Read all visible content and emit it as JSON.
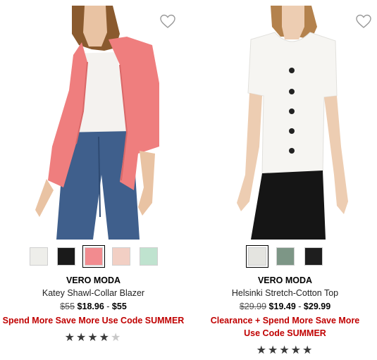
{
  "products": [
    {
      "brand": "VERO MODA",
      "name": "Katey Shawl-Collar Blazer",
      "price_original": "$55",
      "price_sale": "$18.96",
      "price_separator": "-",
      "price_max": "$55",
      "promo": "Spend More Save More Use Code SUMMER",
      "rating_stars": 4,
      "rating_max": 5,
      "swatches": [
        "#eeeeea",
        "#1a1a1a",
        "#f28b8f",
        "#f2cfc4",
        "#bfe3cf"
      ],
      "selected_swatch": 2,
      "wishlist_icon": "heart-outline-icon"
    },
    {
      "brand": "VERO MODA",
      "name": "Helsinki Stretch-Cotton Top",
      "price_original": "$29.99",
      "price_sale": "$19.49",
      "price_separator": "-",
      "price_max": "$29.99",
      "promo": "Clearance + Spend More Save More Use Code SUMMER",
      "rating_stars": 5,
      "rating_max": 5,
      "swatches": [
        "#e4e4e0",
        "#7d9686",
        "#1e1e1e"
      ],
      "selected_swatch": 0,
      "wishlist_icon": "heart-outline-icon"
    }
  ],
  "colors": {
    "promo": "#c00000",
    "star": "#3a3a3a",
    "star_empty": "#c8c8c8"
  }
}
